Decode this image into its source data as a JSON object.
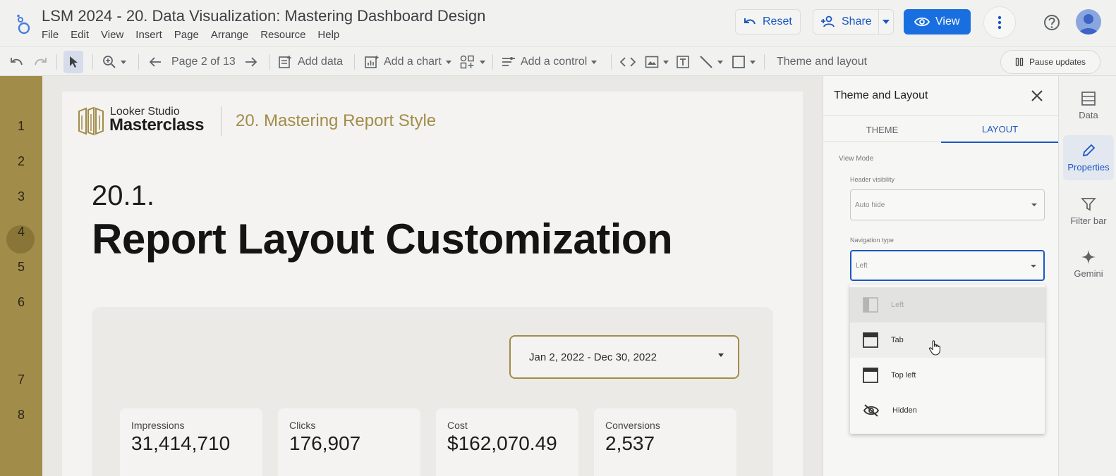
{
  "app": {
    "title": "LSM 2024 - 20. Data Visualization: Mastering Dashboard Design",
    "menu": [
      "File",
      "Edit",
      "View",
      "Insert",
      "Page",
      "Arrange",
      "Resource",
      "Help"
    ],
    "reset_label": "Reset",
    "share_label": "Share",
    "view_label": "View"
  },
  "toolbar": {
    "page_indicator": "Page 2 of 13",
    "add_data_label": "Add data",
    "add_chart_label": "Add a chart",
    "add_control_label": "Add a control",
    "theme_layout_label": "Theme and layout",
    "pause_updates_label": "Pause updates"
  },
  "section_rail": {
    "numbers": [
      "1",
      "2",
      "3",
      "4",
      "5",
      "6",
      "7",
      "8"
    ],
    "active": "2"
  },
  "report": {
    "brand_line1": "Looker Studio",
    "brand_line2": "Masterclass",
    "subtitle": "20. Mastering Report Style",
    "section_number": "20.1.",
    "section_title": "Report Layout Customization",
    "date_range": "Jan 2, 2022 - Dec 30, 2022",
    "kpis": [
      {
        "label": "Impressions",
        "value": "31,414,710"
      },
      {
        "label": "Clicks",
        "value": "176,907"
      },
      {
        "label": "Cost",
        "value": "$162,070.49"
      },
      {
        "label": "Conversions",
        "value": "2,537"
      }
    ]
  },
  "panel": {
    "title": "Theme and Layout",
    "tabs": [
      "THEME",
      "LAYOUT"
    ],
    "active_tab": "LAYOUT",
    "view_mode_label": "View Mode",
    "header_visibility_label": "Header visibility",
    "header_visibility_value": "Auto hide",
    "navigation_type_label": "Navigation type",
    "navigation_type_value": "Left",
    "navigation_options": [
      "Left",
      "Tab",
      "Top left",
      "Hidden"
    ]
  },
  "right_rail": {
    "items": [
      "Data",
      "Properties",
      "Filter bar",
      "Gemini"
    ],
    "active": "Properties"
  },
  "colors": {
    "accent_gold": "#a28c49",
    "primary_blue": "#1a6fe0",
    "link_blue": "#1a56c4"
  }
}
